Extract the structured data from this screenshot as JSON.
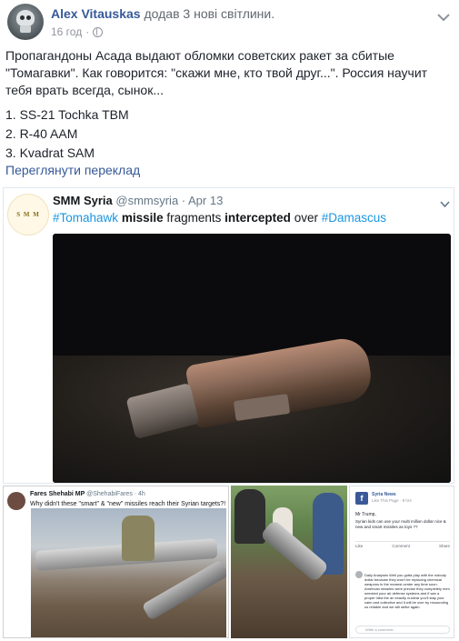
{
  "post": {
    "author": "Alex Vitauskas",
    "action": "додав 3 нові світлини.",
    "date": "16 год",
    "text": "Пропагандоны Асада выдают обломки советских ракет за сбитые \"Томагавки\". Как говорится: \"скажи мне, кто твой друг...\". Россия научит тебя врать всегда, сынок...",
    "list": [
      "1. SS-21 Tochka TBM",
      "2. R-40 AAM",
      "3. Kvadrat SAM"
    ],
    "translate_link": "Переглянути переклад"
  },
  "tweet": {
    "avatar_text": "S M M",
    "name": "SMM Syria",
    "handle": "@smmsyria · Apr 13",
    "text": {
      "tag1": "#Tomahawk",
      "w1": "missile",
      "w2": "fragments",
      "w3": "intercepted",
      "w4": "over",
      "tag2": "#Damascus"
    }
  },
  "photo1": {
    "name": "Fares Shehabi MP",
    "handle": "@ShehabiFares · 4h",
    "text": "Why didn't these \"smart\" & \"new\" missiles reach their Syrian targets?!"
  },
  "photo3": {
    "page": "Syria News",
    "sub": "Like This Page · 9 hrs",
    "to": "Mr Trump,",
    "body": "Syrian kids can use your multi million dollar nice & new and smart missiles as toys ??",
    "actions": [
      "Like",
      "Comment",
      "Share"
    ],
    "comment": "Daily Analyses Well you gotta play with the nobody dollar because they won't be replacing chemical weapons in the nearest center any time soon. American missiles were precise they completely men wrecked your air defense systems and if war a proper idea the an exactly nuclear you'll stay your calm and collective and it will be over by resounding us reliable and we will strike again.",
    "input_placeholder": "Write a comment..."
  }
}
